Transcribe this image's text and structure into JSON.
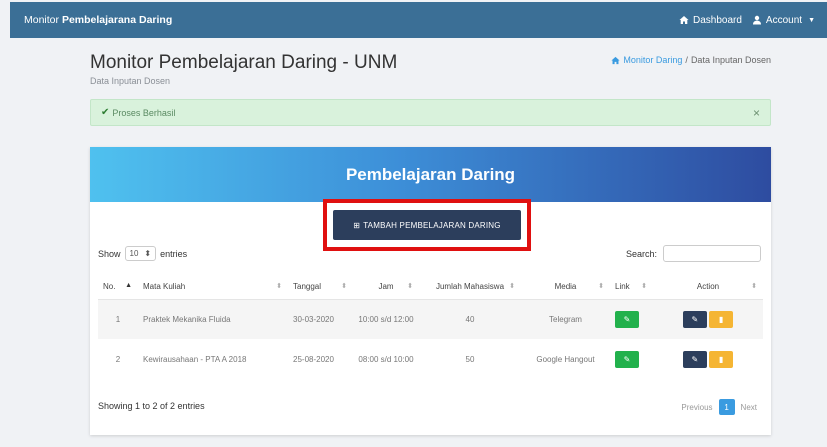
{
  "navbar": {
    "brand_prefix": "Monitor",
    "brand_bold": "Pembelajarana Daring",
    "dashboard_label": "Dashboard",
    "account_label": "Account"
  },
  "header": {
    "title": "Monitor Pembelajaran Daring - UNM",
    "subtitle": "Data Inputan Dosen",
    "breadcrumb_link": "Monitor Daring",
    "breadcrumb_sep": "/",
    "breadcrumb_current": "Data Inputan Dosen"
  },
  "alert": {
    "message": "Proses Berhasil",
    "close": "×"
  },
  "card": {
    "title": "Pembelajaran Daring",
    "add_button": "TAMBAH PEMBELAJARAN DARING",
    "show_label": "Show",
    "entries_value": "10",
    "entries_label": "entries",
    "search_label": "Search:",
    "columns": [
      "No.",
      "Mata Kuliah",
      "Tanggal",
      "Jam",
      "Jumlah Mahasiswa",
      "Media",
      "Link",
      "Action"
    ],
    "rows": [
      {
        "no": "1",
        "course": "Praktek Mekanika Fluida",
        "date": "30-03-2020",
        "time": "10:00 s/d 12:00",
        "students": "40",
        "media": "Telegram"
      },
      {
        "no": "2",
        "course": "Kewirausahaan - PTA A 2018",
        "date": "25-08-2020",
        "time": "08:00 s/d 10:00",
        "students": "50",
        "media": "Google Hangout"
      }
    ],
    "info": "Showing 1 to 2 of 2 entries",
    "pager": {
      "previous": "Previous",
      "current": "1",
      "next": "Next"
    }
  },
  "colors": {
    "navbar": "#3b6f96",
    "add_button": "#2c3e5c",
    "highlight_border": "#e01010",
    "link_button": "#22b14c",
    "edit_button": "#2c3e5c",
    "delete_button": "#f5b533"
  }
}
